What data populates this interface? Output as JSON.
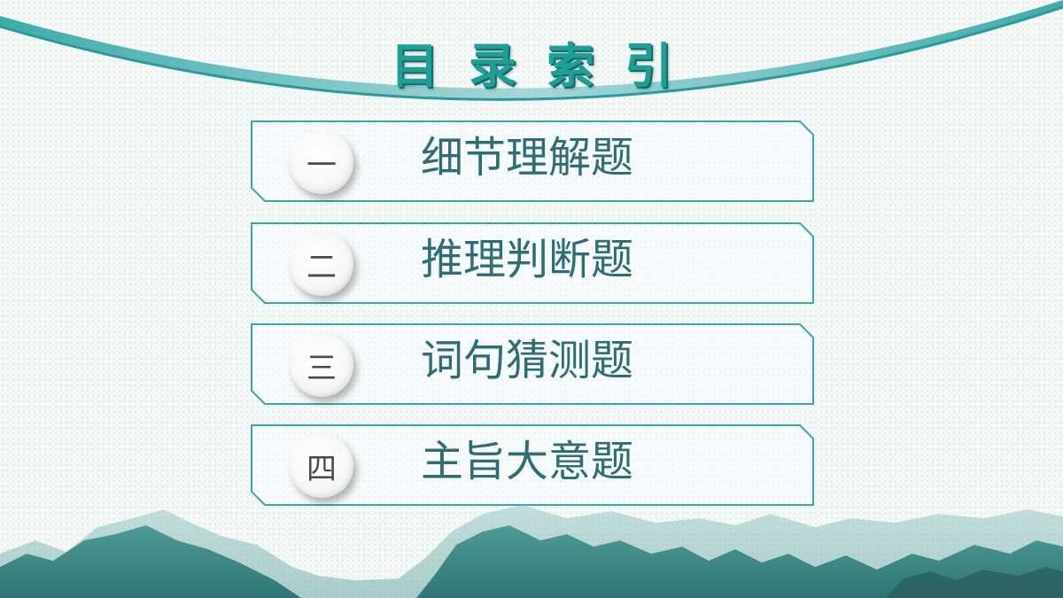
{
  "title": "目录索引",
  "items": [
    {
      "num": "一",
      "label": "细节理解题"
    },
    {
      "num": "二",
      "label": "推理判断题"
    },
    {
      "num": "三",
      "label": "词句猜测题"
    },
    {
      "num": "四",
      "label": "主旨大意题"
    }
  ],
  "colors": {
    "accent": "#1e9e96",
    "label": "#2f6d73",
    "frame": "#3aa6a8",
    "mountain": "#3f8a88"
  }
}
